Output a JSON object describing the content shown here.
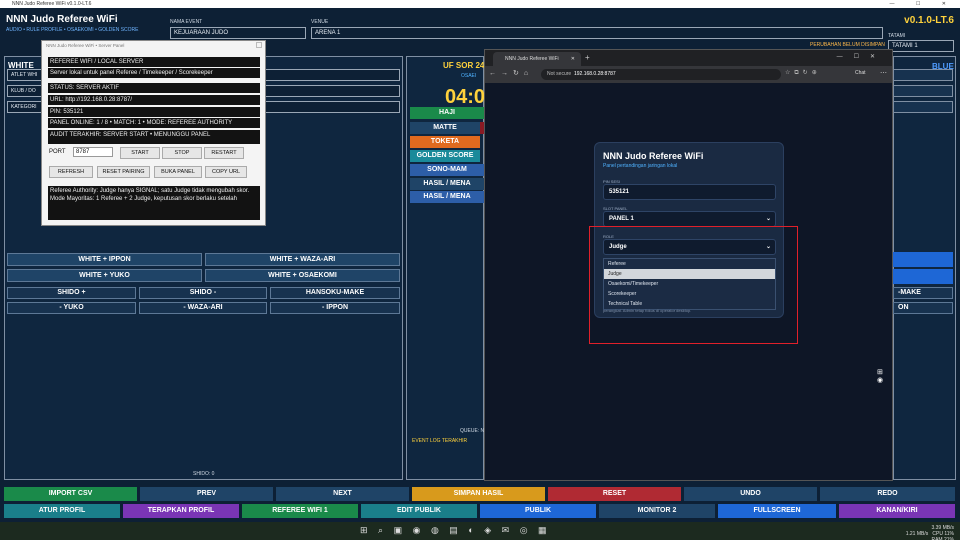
{
  "window": {
    "titlebar": "NNN Judo Referee WiFi v0.1.0-LT.6",
    "app_title": "NNN Judo Referee WiFi",
    "subtitle": "AUDIO • RULE PROFILE • OSAEKOMI • GOLDEN SCORE",
    "version": "v0.1.0-LT.6"
  },
  "header": {
    "event_label": "NAMA EVENT",
    "event_value": "KEJUARAAN JUDO",
    "venue_label": "VENUE",
    "venue_value": "ARENA 1",
    "tatami_label": "TATAMI",
    "tatami_value": "TATAMI 1",
    "unsaved": "PERUBAHAN BELUM DISIMPAN"
  },
  "white_side": {
    "title": "WHITE",
    "athlete_label": "ATLET WHI",
    "club_label": "KLUB / DO",
    "category_label": "KATEGORI",
    "score_buttons": [
      "WHITE + IPPON",
      "WHITE + WAZA-ARI",
      "WHITE + YUKO",
      "WHITE + OSAEKOMI"
    ],
    "penalty_buttons": [
      "SHIDO +",
      "SHIDO -",
      "HANSOKU-MAKE"
    ],
    "minus_buttons": [
      "- YUKO",
      "- WAZA-ARI",
      "- IPPON"
    ],
    "shido_count": "SHIDO: 0"
  },
  "blue_side": {
    "title": "BLUE",
    "hansoku_partial": "-MAKE",
    "ippon_partial": "ON"
  },
  "center": {
    "bout_partial": "UF SOR 24",
    "osae_partial": "OSAEI",
    "timer_partial": "04:0",
    "hajime_partial": "HAJI",
    "matte": "MATTE",
    "toketa": "TOKETA",
    "golden_score": "GOLDEN SCORE",
    "sono_partial": "SONO-MAM",
    "hasil1_partial": "HASIL / MENA",
    "hasil2_partial": "HASIL / MENA",
    "queue_partial": "QUEUE: N",
    "event_log": "EVENT LOG TERAKHIR"
  },
  "server_dialog": {
    "title": "NNN Judo Referee WiFi • Server Panel",
    "heading": "REFEREE WIFI / LOCAL SERVER",
    "description": "Server lokal untuk panel Referee / Timekeeper / Scorekeeper",
    "status": "STATUS: SERVER AKTIF",
    "url": "URL: http://192.168.0.28:8787/",
    "pin": "PIN: 535121",
    "panel_info": "PANEL ONLINE: 1 / 8   •   MATCH: 1   •   MODE: REFEREE AUTHORITY",
    "audit": "AUDIT TERAKHIR: SERVER START • MENUNGGU PANEL",
    "port_label": "PORT",
    "port_value": "8787",
    "start": "START",
    "stop": "STOP",
    "restart": "RESTART",
    "refresh": "REFRESH",
    "reset_pairing": "RESET PAIRING",
    "buka_panel": "BUKA PANEL",
    "copy_url": "COPY URL",
    "note": "Referee Authority: Judge hanya SIGNAL; satu Judge tidak mengubah skor. Mode Mayoritas: 1 Referee + 2 Judge, keputusan skor berlaku setelah"
  },
  "browser": {
    "tab_title": "NNN Judo Referee WiFi",
    "not_secure": "Not secure",
    "address": "192.168.0.28:8787",
    "chat": "Chat",
    "card_title": "NNN Judo Referee WiFi",
    "card_subtitle": "Panel pertandingan jaringan lokal",
    "pin_label": "PIN SESI",
    "pin_value": "535121",
    "slot_label": "SLOT PANEL",
    "slot_value": "PANEL 1",
    "role_label": "ROLE",
    "role_value": "Judge",
    "role_options": [
      "Referee",
      "Judge",
      "Osaekomi/Timekeeper",
      "Scorekeeper",
      "Technical Table"
    ],
    "hint": "perangkat. Admin tetap fokus di operator desktop."
  },
  "bottom_row1": [
    "IMPORT CSV",
    "PREV",
    "NEXT",
    "SIMPAN HASIL",
    "RESET",
    "UNDO",
    "REDO"
  ],
  "bottom_row2": [
    "ATUR PROFIL",
    "TERAPKAN PROFIL",
    "REFEREE WIFI 1",
    "EDIT PUBLIK",
    "PUBLIK",
    "MONITOR 2",
    "FULLSCREEN",
    "KANAN/KIRI"
  ],
  "taskbar": {
    "net": "3.39 MB/s\n1.21 MB/s",
    "cpu": "CPU 11%\nRAM 21%"
  }
}
